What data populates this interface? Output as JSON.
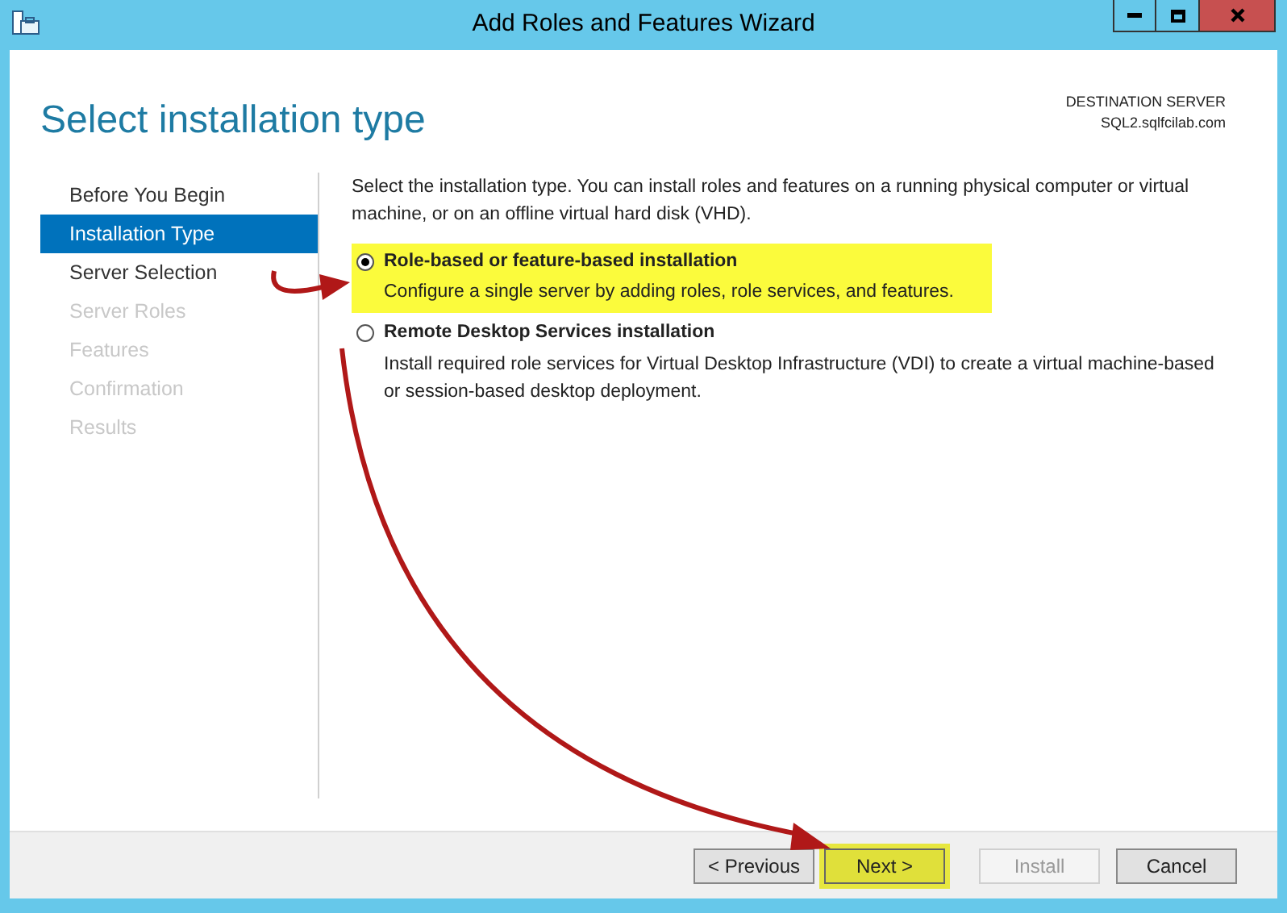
{
  "window": {
    "title": "Add Roles and Features Wizard"
  },
  "header": {
    "title": "Select installation type",
    "destination_label": "DESTINATION SERVER",
    "destination_server": "SQL2.sqlfcilab.com"
  },
  "steps": [
    {
      "label": "Before You Begin",
      "selected": false,
      "disabled": false
    },
    {
      "label": "Installation Type",
      "selected": true,
      "disabled": false
    },
    {
      "label": "Server Selection",
      "selected": false,
      "disabled": false
    },
    {
      "label": "Server Roles",
      "selected": false,
      "disabled": true
    },
    {
      "label": "Features",
      "selected": false,
      "disabled": true
    },
    {
      "label": "Confirmation",
      "selected": false,
      "disabled": true
    },
    {
      "label": "Results",
      "selected": false,
      "disabled": true
    }
  ],
  "intro": "Select the installation type. You can install roles and features on a running physical computer or virtual machine, or on an offline virtual hard disk (VHD).",
  "options": [
    {
      "title": "Role-based or feature-based installation",
      "description": "Configure a single server by adding roles, role services, and features.",
      "selected": true,
      "highlighted": true
    },
    {
      "title": "Remote Desktop Services installation",
      "description": "Install required role services for Virtual Desktop Infrastructure (VDI) to create a virtual machine-based or session-based desktop deployment.",
      "selected": false,
      "highlighted": false
    }
  ],
  "buttons": [
    {
      "label": "< Previous",
      "disabled": false,
      "highlighted": false
    },
    {
      "label": "Next >",
      "disabled": false,
      "highlighted": true
    },
    {
      "label": "Install",
      "disabled": true,
      "highlighted": false
    },
    {
      "label": "Cancel",
      "disabled": false,
      "highlighted": false
    }
  ]
}
